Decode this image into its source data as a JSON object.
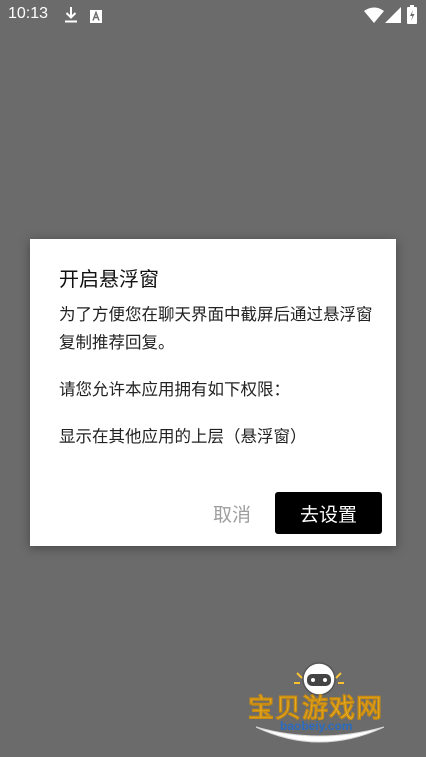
{
  "status_bar": {
    "time": "10:13",
    "icons": [
      "download-icon",
      "keyboard-a-icon",
      "wifi-icon",
      "signal-icon",
      "battery-charging-icon"
    ]
  },
  "dialog": {
    "title": "开启悬浮窗",
    "paragraphs": [
      "为了方便您在聊天界面中截屏后通过悬浮窗复制推荐回复。",
      "请您允许本应用拥有如下权限：",
      "显示在其他应用的上层（悬浮窗）"
    ],
    "cancel_label": "取消",
    "confirm_label": "去设置"
  },
  "watermark": {
    "text": "宝贝游戏网",
    "url": "baobeiy.com"
  },
  "colors": {
    "backdrop": "#6b6b6b",
    "dialog_bg": "#ffffff",
    "confirm_bg": "#000000",
    "cancel_text": "#9e9e9e"
  }
}
